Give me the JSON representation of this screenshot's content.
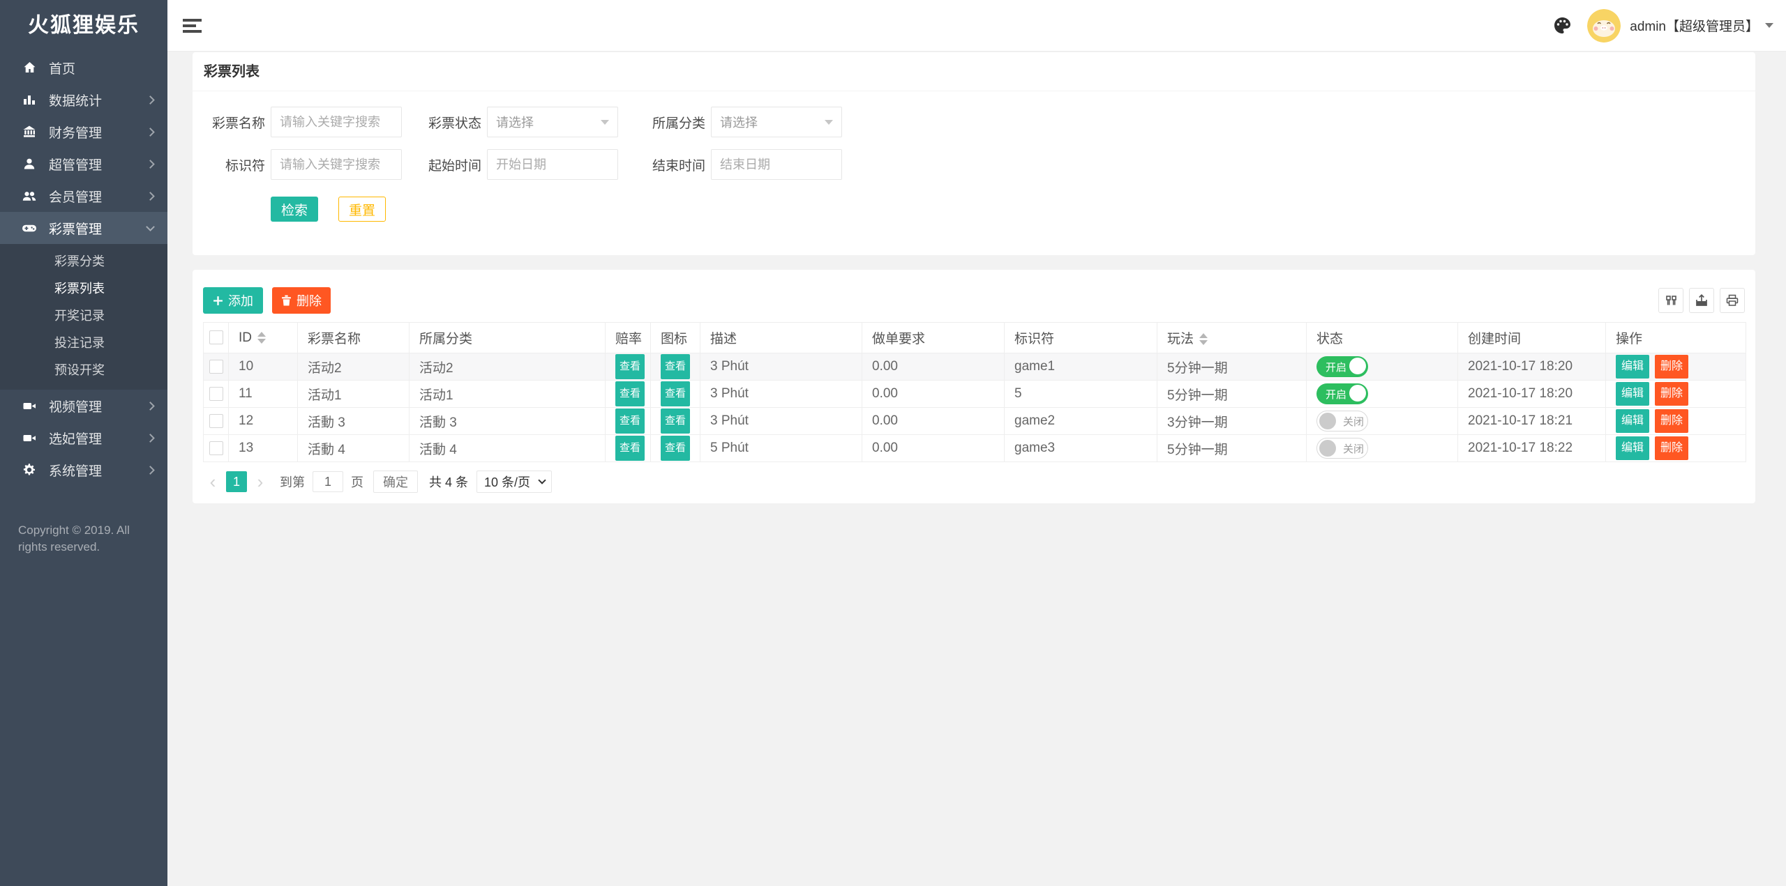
{
  "app": {
    "title": "火狐狸娱乐"
  },
  "header": {
    "user": "admin【超级管理员】"
  },
  "sidebar": {
    "items": [
      {
        "label": "首页",
        "icon": "home-icon"
      },
      {
        "label": "数据统计",
        "icon": "chart-icon"
      },
      {
        "label": "财务管理",
        "icon": "bank-icon"
      },
      {
        "label": "超管管理",
        "icon": "user-icon"
      },
      {
        "label": "会员管理",
        "icon": "users-icon"
      },
      {
        "label": "彩票管理",
        "icon": "gamepad-icon",
        "children": [
          "彩票分类",
          "彩票列表",
          "开奖记录",
          "投注记录",
          "预设开奖"
        ]
      },
      {
        "label": "视频管理",
        "icon": "video-icon"
      },
      {
        "label": "选妃管理",
        "icon": "video-icon"
      },
      {
        "label": "系统管理",
        "icon": "gear-icon"
      }
    ],
    "copyright": "Copyright © 2019. All rights reserved."
  },
  "page": {
    "title": "彩票列表"
  },
  "filters": {
    "fields": [
      {
        "label": "彩票名称",
        "placeholder": "请输入关键字搜索"
      },
      {
        "label": "彩票状态",
        "value": "请选择"
      },
      {
        "label": "所属分类",
        "value": "请选择"
      },
      {
        "label": "标识符",
        "placeholder": "请输入关键字搜索"
      },
      {
        "label": "起始时间",
        "placeholder": "开始日期"
      },
      {
        "label": "结束时间",
        "placeholder": "结束日期"
      }
    ],
    "search_label": "检索",
    "reset_label": "重置"
  },
  "table": {
    "toolbar": {
      "add": "添加",
      "delete": "删除"
    },
    "columns": [
      "ID",
      "彩票名称",
      "所属分类",
      "赔率",
      "图标",
      "描述",
      "做单要求",
      "标识符",
      "玩法",
      "状态",
      "创建时间",
      "操作"
    ],
    "view_label": "查看",
    "edit_label": "编辑",
    "delete_label": "删除",
    "on_label": "开启",
    "off_label": "关闭",
    "rows": [
      {
        "id": "10",
        "name": "活动2",
        "category": "活动2",
        "desc": "3 Phút",
        "requirement": "0.00",
        "identifier": "game1",
        "play": "5分钟一期",
        "status": "on",
        "created": "2021-10-17 18:20"
      },
      {
        "id": "11",
        "name": "活动1",
        "category": "活动1",
        "desc": "3 Phút",
        "requirement": "0.00",
        "identifier": "5",
        "play": "5分钟一期",
        "status": "on",
        "created": "2021-10-17 18:20"
      },
      {
        "id": "12",
        "name": "活動 3",
        "category": "活動 3",
        "desc": "3 Phút",
        "requirement": "0.00",
        "identifier": "game2",
        "play": "3分钟一期",
        "status": "off",
        "created": "2021-10-17 18:21"
      },
      {
        "id": "13",
        "name": "活動 4",
        "category": "活動 4",
        "desc": "5 Phút",
        "requirement": "0.00",
        "identifier": "game3",
        "play": "5分钟一期",
        "status": "off",
        "created": "2021-10-17 18:22"
      }
    ],
    "pagination": {
      "prev": "‹",
      "next": "›",
      "current": "1",
      "goto_prefix": "到第",
      "goto_value": "1",
      "goto_suffix": "页",
      "confirm": "确定",
      "total": "共 4 条",
      "page_size": "10 条/页"
    }
  },
  "colors": {
    "teal": "#23B9A2",
    "orange": "#FF5722",
    "toggle_green": "#2DBE5F",
    "yellow": "#FFB800",
    "sidebar_bg": "#3E4A59"
  }
}
